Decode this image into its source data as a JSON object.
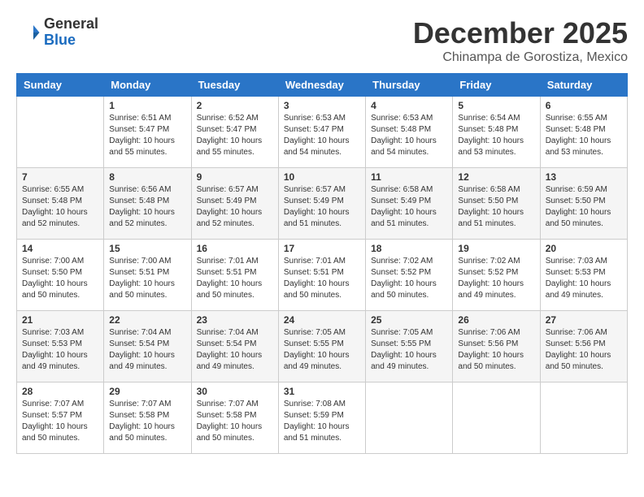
{
  "header": {
    "logo_general": "General",
    "logo_blue": "Blue",
    "month_title": "December 2025",
    "location": "Chinampa de Gorostiza, Mexico"
  },
  "weekdays": [
    "Sunday",
    "Monday",
    "Tuesday",
    "Wednesday",
    "Thursday",
    "Friday",
    "Saturday"
  ],
  "weeks": [
    [
      {
        "day": "",
        "info": ""
      },
      {
        "day": "1",
        "info": "Sunrise: 6:51 AM\nSunset: 5:47 PM\nDaylight: 10 hours\nand 55 minutes."
      },
      {
        "day": "2",
        "info": "Sunrise: 6:52 AM\nSunset: 5:47 PM\nDaylight: 10 hours\nand 55 minutes."
      },
      {
        "day": "3",
        "info": "Sunrise: 6:53 AM\nSunset: 5:47 PM\nDaylight: 10 hours\nand 54 minutes."
      },
      {
        "day": "4",
        "info": "Sunrise: 6:53 AM\nSunset: 5:48 PM\nDaylight: 10 hours\nand 54 minutes."
      },
      {
        "day": "5",
        "info": "Sunrise: 6:54 AM\nSunset: 5:48 PM\nDaylight: 10 hours\nand 53 minutes."
      },
      {
        "day": "6",
        "info": "Sunrise: 6:55 AM\nSunset: 5:48 PM\nDaylight: 10 hours\nand 53 minutes."
      }
    ],
    [
      {
        "day": "7",
        "info": "Sunrise: 6:55 AM\nSunset: 5:48 PM\nDaylight: 10 hours\nand 52 minutes."
      },
      {
        "day": "8",
        "info": "Sunrise: 6:56 AM\nSunset: 5:48 PM\nDaylight: 10 hours\nand 52 minutes."
      },
      {
        "day": "9",
        "info": "Sunrise: 6:57 AM\nSunset: 5:49 PM\nDaylight: 10 hours\nand 52 minutes."
      },
      {
        "day": "10",
        "info": "Sunrise: 6:57 AM\nSunset: 5:49 PM\nDaylight: 10 hours\nand 51 minutes."
      },
      {
        "day": "11",
        "info": "Sunrise: 6:58 AM\nSunset: 5:49 PM\nDaylight: 10 hours\nand 51 minutes."
      },
      {
        "day": "12",
        "info": "Sunrise: 6:58 AM\nSunset: 5:50 PM\nDaylight: 10 hours\nand 51 minutes."
      },
      {
        "day": "13",
        "info": "Sunrise: 6:59 AM\nSunset: 5:50 PM\nDaylight: 10 hours\nand 50 minutes."
      }
    ],
    [
      {
        "day": "14",
        "info": "Sunrise: 7:00 AM\nSunset: 5:50 PM\nDaylight: 10 hours\nand 50 minutes."
      },
      {
        "day": "15",
        "info": "Sunrise: 7:00 AM\nSunset: 5:51 PM\nDaylight: 10 hours\nand 50 minutes."
      },
      {
        "day": "16",
        "info": "Sunrise: 7:01 AM\nSunset: 5:51 PM\nDaylight: 10 hours\nand 50 minutes."
      },
      {
        "day": "17",
        "info": "Sunrise: 7:01 AM\nSunset: 5:51 PM\nDaylight: 10 hours\nand 50 minutes."
      },
      {
        "day": "18",
        "info": "Sunrise: 7:02 AM\nSunset: 5:52 PM\nDaylight: 10 hours\nand 50 minutes."
      },
      {
        "day": "19",
        "info": "Sunrise: 7:02 AM\nSunset: 5:52 PM\nDaylight: 10 hours\nand 49 minutes."
      },
      {
        "day": "20",
        "info": "Sunrise: 7:03 AM\nSunset: 5:53 PM\nDaylight: 10 hours\nand 49 minutes."
      }
    ],
    [
      {
        "day": "21",
        "info": "Sunrise: 7:03 AM\nSunset: 5:53 PM\nDaylight: 10 hours\nand 49 minutes."
      },
      {
        "day": "22",
        "info": "Sunrise: 7:04 AM\nSunset: 5:54 PM\nDaylight: 10 hours\nand 49 minutes."
      },
      {
        "day": "23",
        "info": "Sunrise: 7:04 AM\nSunset: 5:54 PM\nDaylight: 10 hours\nand 49 minutes."
      },
      {
        "day": "24",
        "info": "Sunrise: 7:05 AM\nSunset: 5:55 PM\nDaylight: 10 hours\nand 49 minutes."
      },
      {
        "day": "25",
        "info": "Sunrise: 7:05 AM\nSunset: 5:55 PM\nDaylight: 10 hours\nand 49 minutes."
      },
      {
        "day": "26",
        "info": "Sunrise: 7:06 AM\nSunset: 5:56 PM\nDaylight: 10 hours\nand 50 minutes."
      },
      {
        "day": "27",
        "info": "Sunrise: 7:06 AM\nSunset: 5:56 PM\nDaylight: 10 hours\nand 50 minutes."
      }
    ],
    [
      {
        "day": "28",
        "info": "Sunrise: 7:07 AM\nSunset: 5:57 PM\nDaylight: 10 hours\nand 50 minutes."
      },
      {
        "day": "29",
        "info": "Sunrise: 7:07 AM\nSunset: 5:58 PM\nDaylight: 10 hours\nand 50 minutes."
      },
      {
        "day": "30",
        "info": "Sunrise: 7:07 AM\nSunset: 5:58 PM\nDaylight: 10 hours\nand 50 minutes."
      },
      {
        "day": "31",
        "info": "Sunrise: 7:08 AM\nSunset: 5:59 PM\nDaylight: 10 hours\nand 51 minutes."
      },
      {
        "day": "",
        "info": ""
      },
      {
        "day": "",
        "info": ""
      },
      {
        "day": "",
        "info": ""
      }
    ]
  ]
}
